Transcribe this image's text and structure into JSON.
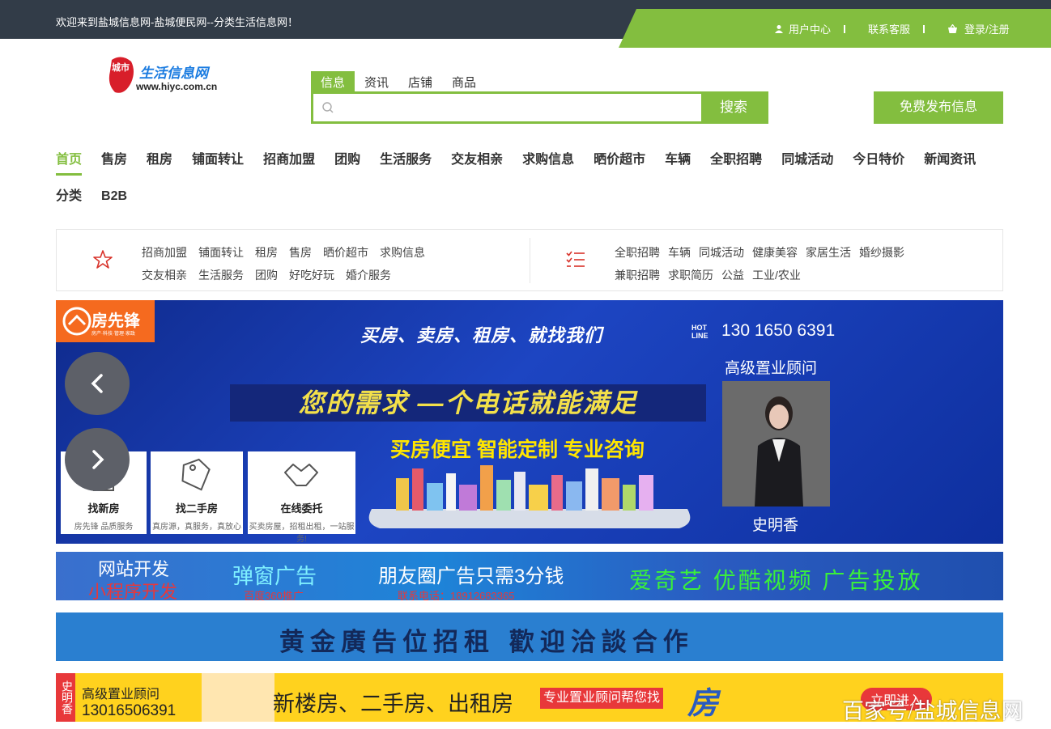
{
  "topbar": {
    "welcome": "欢迎来到盐城信息网-盐城便民网--分类生活信息网！",
    "user_center": "用户中心",
    "contact": "联系客服",
    "login": "登录/注册"
  },
  "logo": {
    "text": "生活信息网",
    "url_text": "www.hiyc.com.cn",
    "mark": "城市"
  },
  "search": {
    "tabs": [
      "信息",
      "资讯",
      "店铺",
      "商品"
    ],
    "placeholder": "",
    "button": "搜索"
  },
  "post_button": "免费发布信息",
  "nav": {
    "row1": [
      "首页",
      "售房",
      "租房",
      "铺面转让",
      "招商加盟",
      "团购",
      "生活服务",
      "交友相亲",
      "求购信息",
      "晒价超市",
      "车辆",
      "全职招聘",
      "同城活动",
      "今日特价",
      "新闻资讯"
    ],
    "row2": [
      "分类",
      "B2B"
    ]
  },
  "categories": {
    "left": {
      "row1": [
        "招商加盟",
        "铺面转让",
        "租房",
        "售房",
        "晒价超市",
        "求购信息"
      ],
      "row2": [
        "交友相亲",
        "生活服务",
        "团购",
        "好吃好玩",
        "婚介服务"
      ]
    },
    "right": {
      "row1": [
        "全职招聘",
        "车辆",
        "同城活动",
        "健康美容",
        "家居生活",
        "婚纱摄影"
      ],
      "row2": [
        "兼职招聘",
        "求职简历",
        "公益",
        "工业/农业"
      ]
    }
  },
  "banner": {
    "logo": "房先锋",
    "logo_sub": "房产·科技·管理·家政",
    "slogan": "买房、卖房、租房、就找我们",
    "hot_line": "HOT LINE",
    "phone": "130 1650 6391",
    "role": "高级置业顾问",
    "name": "史明香",
    "headline": "您的需求 —个电话就能满足",
    "sub": "买房便宜 智能定制 专业咨询",
    "cards": [
      {
        "title": "找新房",
        "sub": "房先锋 品质服务"
      },
      {
        "title": "找二手房",
        "sub": "真房源，真服务，真放心"
      },
      {
        "title": "在线委托",
        "sub": "买卖房屋，招租出租，一站服务!"
      }
    ]
  },
  "ads": {
    "ad1": {
      "t1": "网站开发",
      "t2": "小程序开发",
      "t3": "弹窗广告",
      "t4": "百度360推广",
      "t5": "朋友圈广告只需3分钱",
      "t6": "联系电话：18912683365",
      "t7": "爱奇艺 优酷视频 广告投放"
    },
    "ad2": {
      "text": "黄金廣告位招租 歡迎洽談合作"
    },
    "ad3": {
      "name": "史明香",
      "role": "高级置业顾问",
      "phone": "13016506391",
      "main": "新楼房、二手房、出租房",
      "tag": "专业置业顾问帮您找",
      "char": "房",
      "cta": "立即进入"
    }
  },
  "watermark": "百家号/盐城信息网"
}
